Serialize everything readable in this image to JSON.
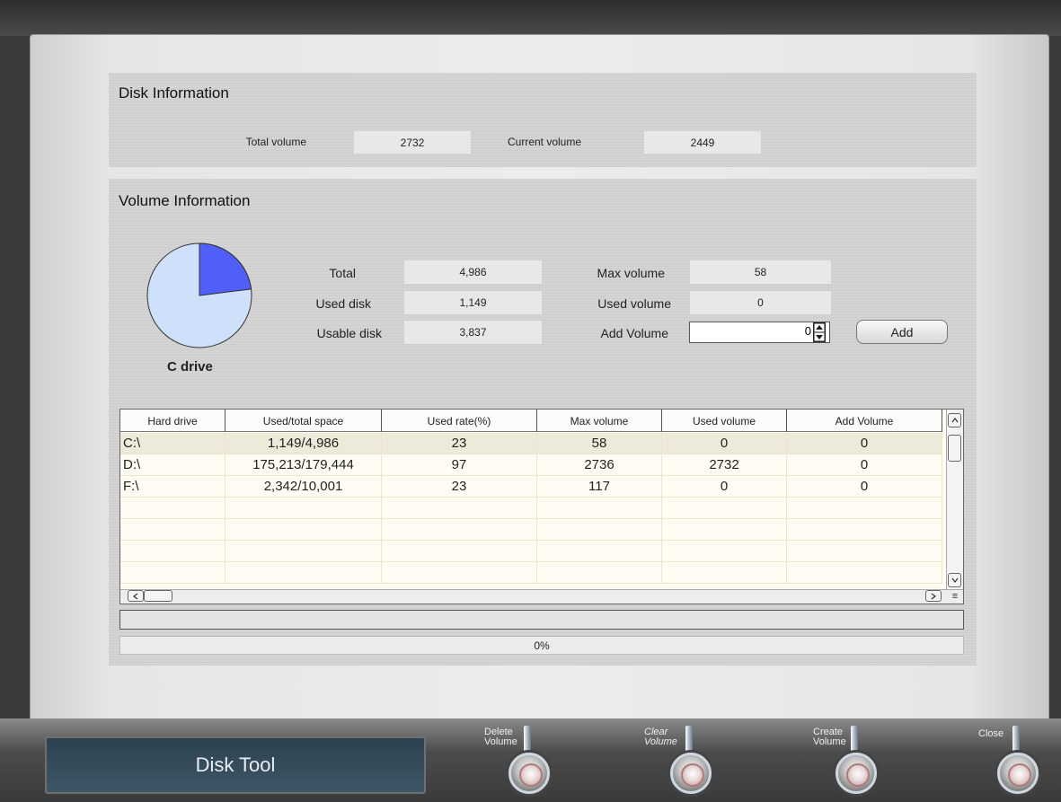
{
  "disk_info": {
    "title": "Disk Information",
    "total_volume_label": "Total volume",
    "total_volume_value": "2732",
    "current_volume_label": "Current volume",
    "current_volume_value": "2449"
  },
  "volume_info": {
    "title": "Volume Information",
    "drive_label": "C drive",
    "pie": {
      "used": 1149,
      "total": 4986,
      "used_color": "#4f5ff7",
      "free_color": "#cfe0fb"
    },
    "total_label": "Total",
    "total_value": "4,986",
    "used_disk_label": "Used disk",
    "used_disk_value": "1,149",
    "usable_disk_label": "Usable disk",
    "usable_disk_value": "3,837",
    "max_volume_label": "Max volume",
    "max_volume_value": "58",
    "used_volume_label": "Used volume",
    "used_volume_value": "0",
    "add_volume_label": "Add Volume",
    "add_volume_input": "0",
    "add_button": "Add"
  },
  "table": {
    "headers": [
      "Hard drive",
      "Used/total space",
      "Used rate(%)",
      "Max volume",
      "Used volume",
      "Add Volume"
    ],
    "rows": [
      [
        "C:\\",
        "1,149/4,986",
        "23",
        "58",
        "0",
        "0"
      ],
      [
        "D:\\",
        "175,213/179,444",
        "97",
        "2736",
        "2732",
        "0"
      ],
      [
        "F:\\",
        "2,342/10,001",
        "23",
        "117",
        "0",
        "0"
      ]
    ]
  },
  "progress": {
    "text": "0%",
    "fraction": 0
  },
  "footer": {
    "title": "Disk Tool",
    "actions": [
      {
        "label1": "Delete",
        "label2": "Volume",
        "italic": false
      },
      {
        "label1": "Clear",
        "label2": "Volume",
        "italic": true
      },
      {
        "label1": "Create",
        "label2": "Volume",
        "italic": false
      },
      {
        "label1": "Close",
        "label2": "",
        "italic": false
      }
    ]
  }
}
